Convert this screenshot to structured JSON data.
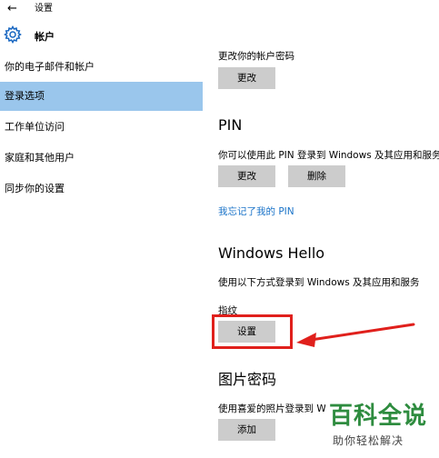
{
  "window": {
    "back_glyph": "←",
    "title": "设置"
  },
  "header": {
    "icon": "gear-icon",
    "title": "帐户"
  },
  "sidebar": {
    "items": [
      {
        "label": "你的电子邮件和帐户",
        "active": false
      },
      {
        "label": "登录选项",
        "active": true
      },
      {
        "label": "工作单位访问",
        "active": false
      },
      {
        "label": "家庭和其他用户",
        "active": false
      },
      {
        "label": "同步你的设置",
        "active": false
      }
    ]
  },
  "password": {
    "description": "更改你的帐户密码",
    "change_label": "更改"
  },
  "pin": {
    "heading": "PIN",
    "description": "你可以使用此 PIN 登录到 Windows 及其应用和服务",
    "change_label": "更改",
    "remove_label": "删除",
    "forgot_link": "我忘记了我的 PIN"
  },
  "hello": {
    "heading": "Windows Hello",
    "description": "使用以下方式登录到 Windows 及其应用和服务",
    "fingerprint_label": "指纹",
    "setup_label": "设置"
  },
  "picture_password": {
    "heading": "图片密码",
    "description": "使用喜爱的照片登录到 W",
    "add_label": "添加"
  },
  "watermark": {
    "title": "百科全说",
    "subtitle": "助你轻松解决"
  },
  "colors": {
    "accent": "#9ac6ec",
    "link": "#1a73c8",
    "highlight": "#e0201c",
    "button": "#cccccc"
  }
}
